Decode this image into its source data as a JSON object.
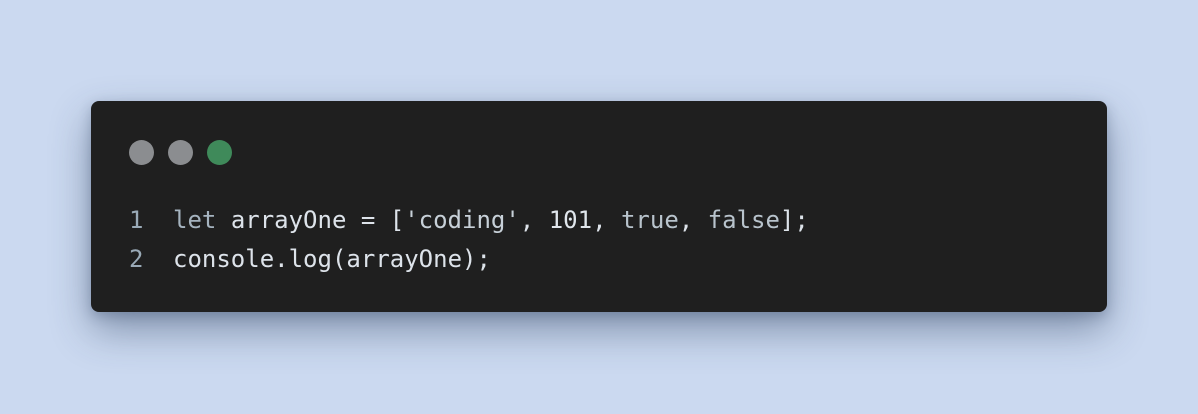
{
  "theme": {
    "background": "#cbd9f0",
    "window_bg": "#1f1f1f",
    "line_number": "#9aaab7",
    "keyword": "#a5b3bf",
    "identifier": "#dde3ea",
    "punctuation": "#dde3ea",
    "string": "#c7d0d8",
    "number": "#e0e6ec",
    "boolean": "#b8c3cc"
  },
  "window_controls": [
    {
      "name": "close",
      "color": "#8b8d90"
    },
    {
      "name": "minimize",
      "color": "#8b8d90"
    },
    {
      "name": "maximize",
      "color": "#3f8a5a"
    }
  ],
  "code_lines": [
    {
      "number": "1",
      "tokens": [
        {
          "text": "let",
          "type": "keyword"
        },
        {
          "text": " ",
          "type": "punctuation"
        },
        {
          "text": "arrayOne",
          "type": "identifier"
        },
        {
          "text": " = [",
          "type": "punctuation"
        },
        {
          "text": "'coding'",
          "type": "string"
        },
        {
          "text": ", ",
          "type": "punctuation"
        },
        {
          "text": "101",
          "type": "number"
        },
        {
          "text": ", ",
          "type": "punctuation"
        },
        {
          "text": "true",
          "type": "boolean"
        },
        {
          "text": ", ",
          "type": "punctuation"
        },
        {
          "text": "false",
          "type": "boolean"
        },
        {
          "text": "];",
          "type": "punctuation"
        }
      ]
    },
    {
      "number": "2",
      "tokens": [
        {
          "text": "console",
          "type": "identifier"
        },
        {
          "text": ".",
          "type": "punctuation"
        },
        {
          "text": "log",
          "type": "identifier"
        },
        {
          "text": "(",
          "type": "punctuation"
        },
        {
          "text": "arrayOne",
          "type": "identifier"
        },
        {
          "text": ");",
          "type": "punctuation"
        }
      ]
    }
  ]
}
